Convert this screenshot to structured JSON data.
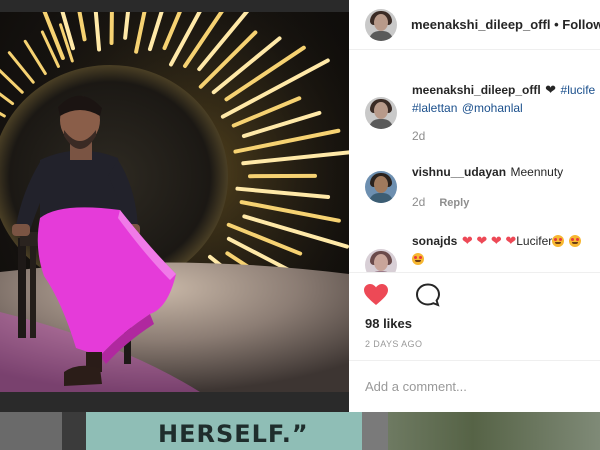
{
  "post": {
    "username": "meenakshi_dileep_offl",
    "separator": "•",
    "follow_label": "Followin",
    "caption": {
      "username": "meenakshi_dileep_offl",
      "heart": "❤",
      "tags": [
        "#lucife",
        "#lalettan",
        "@mohanlal"
      ],
      "time": "2d"
    },
    "comments": [
      {
        "username": "vishnu__udayan",
        "text": "Meennuty",
        "time": "2d",
        "reply_label": "Reply"
      },
      {
        "username": "sonajds",
        "hearts": "❤ ❤ ❤ ❤",
        "text": "Lucifer"
      }
    ],
    "likes": "98 likes",
    "time_ago": "2 DAYS AGO",
    "add_comment_placeholder": "Add a comment..."
  },
  "bottom_banner": {
    "quote": "HERSELF.”"
  },
  "colors": {
    "like_red": "#ed4956",
    "hashtag_blue": "#1a4f8c",
    "dhoti_magenta": "#e53bd9"
  },
  "icons": [
    "like-heart-icon",
    "comment-bubble-icon",
    "avatar-icon",
    "heart-eyes-emoji"
  ]
}
